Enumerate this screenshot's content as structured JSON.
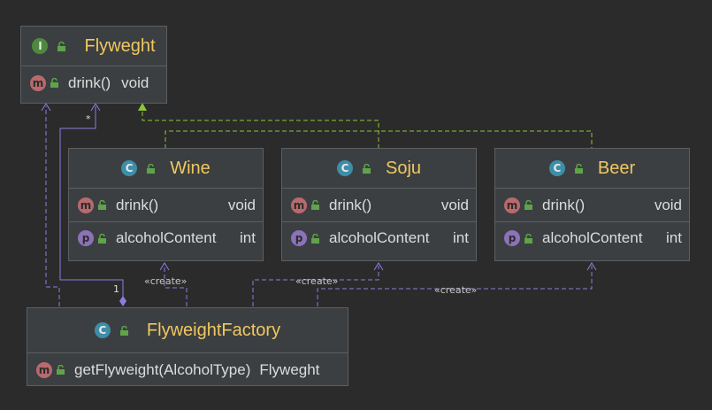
{
  "interface": {
    "badge": "I",
    "name": "Flyweght",
    "methods": [
      {
        "badge": "m",
        "name": "drink()",
        "type": "void"
      }
    ]
  },
  "classes": [
    {
      "badge": "C",
      "name": "Wine",
      "members": [
        {
          "badge": "m",
          "name": "drink()",
          "type": "void"
        },
        {
          "badge": "p",
          "name": "alcoholContent",
          "type": "int"
        }
      ]
    },
    {
      "badge": "C",
      "name": "Soju",
      "members": [
        {
          "badge": "m",
          "name": "drink()",
          "type": "void"
        },
        {
          "badge": "p",
          "name": "alcoholContent",
          "type": "int"
        }
      ]
    },
    {
      "badge": "C",
      "name": "Beer",
      "members": [
        {
          "badge": "m",
          "name": "drink()",
          "type": "void"
        },
        {
          "badge": "p",
          "name": "alcoholContent",
          "type": "int"
        }
      ]
    }
  ],
  "factory": {
    "badge": "C",
    "name": "FlyweightFactory",
    "methods": [
      {
        "badge": "m",
        "name": "getFlyweight(AlcoholType)",
        "type": "Flyweght"
      }
    ]
  },
  "relations": {
    "create_label": "«create»",
    "multiplicity_many": "*",
    "multiplicity_one": "1"
  },
  "colors": {
    "background": "#2b2b2b",
    "class_fill": "#3c3f41",
    "title": "#f0c860",
    "association": "#8a7fe0",
    "realization": "#8ec43a"
  }
}
